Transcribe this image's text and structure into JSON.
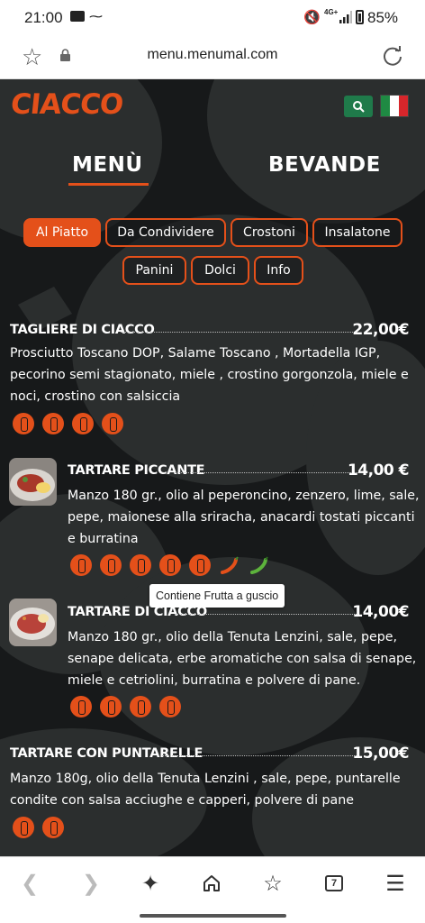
{
  "status_bar": {
    "time": "21:00",
    "network": "4G+",
    "battery": "85%"
  },
  "browser": {
    "url": "menu.menumal.com"
  },
  "site": {
    "logo": "CIACCO",
    "tabs": [
      {
        "label": "MENÙ",
        "active": true
      },
      {
        "label": "BEVANDE",
        "active": false
      }
    ],
    "categories": [
      "Al Piatto",
      "Da Condividere",
      "Crostoni",
      "Insalatone",
      "Panini",
      "Dolci",
      "Info"
    ],
    "active_category": "Al Piatto",
    "colors": {
      "accent": "#e4501a",
      "background": "#17191a",
      "search_button": "#1f7a4a"
    }
  },
  "items": [
    {
      "title": "TAGLIERE DI CIACCO",
      "price": "22,00€",
      "desc_lines": [
        "Prosciutto Toscano DOP, Salame Toscano , Mortadella IGP,",
        "pecorino semi stagionato, miele , crostino gorgonzola, miele e",
        "noci, crostino con salsiccia"
      ],
      "icons": [
        "gluten-icon",
        "milk-icon",
        "sulfites-icon",
        "mustard-icon"
      ]
    },
    {
      "title": "TARTARE PICCANTE",
      "price": "14,00 €",
      "desc_lines": [
        "Manzo 180 gr., olio al peperoncino, zenzero, lime, sale,",
        "pepe, maionese alla sriracha, anacardi tostati piccanti",
        "e burratina"
      ],
      "icons": [
        "egg-icon",
        "milk-icon",
        "sulfites-icon",
        "nuts-icon",
        "soy-icon",
        "chili-pepper-icon",
        "green-pepper-icon"
      ]
    },
    {
      "title": "TARTARE DI CIACCO",
      "price": "14,00€",
      "desc_lines": [
        "Manzo 180 gr., olio della Tenuta Lenzini, sale, pepe,",
        "senape delicata, erbe aromatiche con salsa di senape,",
        "miele e cetriolini, burratina e polvere di pane."
      ],
      "icons": [
        "gluten-icon",
        "egg-icon",
        "sulfites-icon",
        "mustard-icon"
      ]
    },
    {
      "title": "TARTARE CON PUNTARELLE",
      "price": "15,00€",
      "desc_lines": [
        "Manzo 180g, olio della Tenuta Lenzini , sale, pepe, puntarelle",
        "condite con salsa acciughe e capperi, polvere di pane"
      ],
      "icons": [
        "gluten-icon",
        "fish-icon"
      ]
    }
  ],
  "tooltip": "Contiene Frutta a guscio",
  "bottom_nav": {
    "tab_count": "7"
  }
}
